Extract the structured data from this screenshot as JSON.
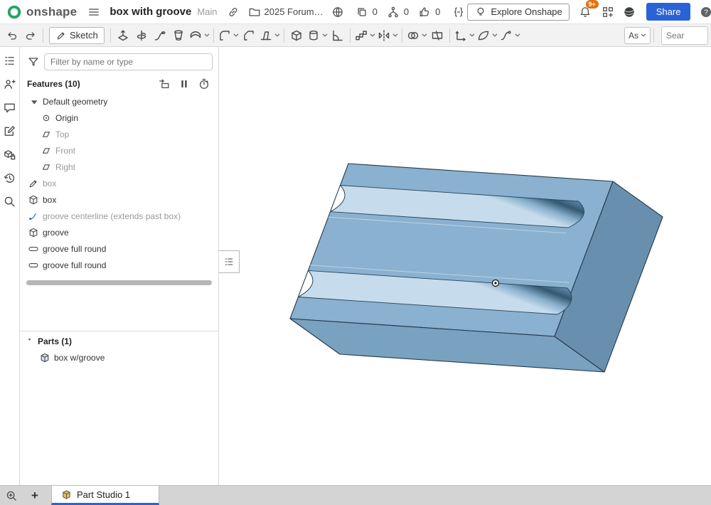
{
  "header": {
    "logo": "onshape",
    "title": "box with groove",
    "branch": "Main",
    "folder": "2025 Forum…",
    "stats": [
      {
        "icon": "copy",
        "value": "0"
      },
      {
        "icon": "fork",
        "value": "0"
      },
      {
        "icon": "thumb",
        "value": "0"
      }
    ],
    "explore": "Explore Onshape",
    "badge": "9+",
    "share": "Share"
  },
  "toolbar": {
    "sketch": "Sketch",
    "as": "As",
    "search_placeholder": "Sear",
    "tool_groups": [
      [
        {
          "name": "extrude",
          "chev": false
        },
        {
          "name": "revolve",
          "chev": false
        },
        {
          "name": "sweep",
          "chev": false
        },
        {
          "name": "loft",
          "chev": false
        },
        {
          "name": "thicken",
          "chev": true
        }
      ],
      [
        {
          "name": "fillet",
          "chev": true
        },
        {
          "name": "chamfer",
          "chev": false
        },
        {
          "name": "draft",
          "chev": true
        }
      ],
      [
        {
          "name": "shell",
          "chev": false
        },
        {
          "name": "hole",
          "chev": true
        },
        {
          "name": "rib",
          "chev": false
        }
      ],
      [
        {
          "name": "linear-pattern",
          "chev": true
        },
        {
          "name": "mirror",
          "chev": true
        }
      ],
      [
        {
          "name": "boolean",
          "chev": true
        },
        {
          "name": "split",
          "chev": false
        }
      ],
      [
        {
          "name": "transform",
          "chev": true
        },
        {
          "name": "surface",
          "chev": true
        },
        {
          "name": "curve",
          "chev": true
        }
      ]
    ]
  },
  "side_icons": [
    {
      "name": "feature-list"
    },
    {
      "name": "collaborate"
    },
    {
      "name": "comments"
    },
    {
      "name": "notes"
    },
    {
      "name": "standard-content"
    },
    {
      "name": "history"
    },
    {
      "name": "search-tools"
    }
  ],
  "panel": {
    "filter_placeholder": "Filter by name or type",
    "features_title": "Features (10)",
    "parts_title": "Parts (1)",
    "tree": [
      {
        "label": "Default geometry",
        "icon": "group",
        "indent": 0,
        "muted": false
      },
      {
        "label": "Origin",
        "icon": "origin",
        "indent": 1,
        "muted": false
      },
      {
        "label": "Top",
        "icon": "plane",
        "indent": 1,
        "muted": true
      },
      {
        "label": "Front",
        "icon": "plane",
        "indent": 1,
        "muted": true
      },
      {
        "label": "Right",
        "icon": "plane",
        "indent": 1,
        "muted": true
      },
      {
        "label": "box",
        "icon": "sketch",
        "indent": 0,
        "muted": true
      },
      {
        "label": "box",
        "icon": "extrude",
        "indent": 0,
        "muted": false
      },
      {
        "label": "groove centerline (extends past box)",
        "icon": "curve-sketch",
        "indent": 0,
        "muted": true
      },
      {
        "label": "groove",
        "icon": "extrude",
        "indent": 0,
        "muted": false
      },
      {
        "label": "groove full round",
        "icon": "fullround",
        "indent": 0,
        "muted": false
      },
      {
        "label": "groove full round",
        "icon": "fullround",
        "indent": 0,
        "muted": false
      }
    ],
    "parts": [
      {
        "label": "box w/groove",
        "icon": "part"
      }
    ]
  },
  "tabs": {
    "plus": "+",
    "active": "Part Studio 1"
  },
  "colors": {
    "accent": "#2a63d8",
    "badge": "#e8710a",
    "logo_green": "#23a566",
    "part_top": "#8ab1cf",
    "part_front": "#79a1c0",
    "part_right": "#6890ae"
  }
}
